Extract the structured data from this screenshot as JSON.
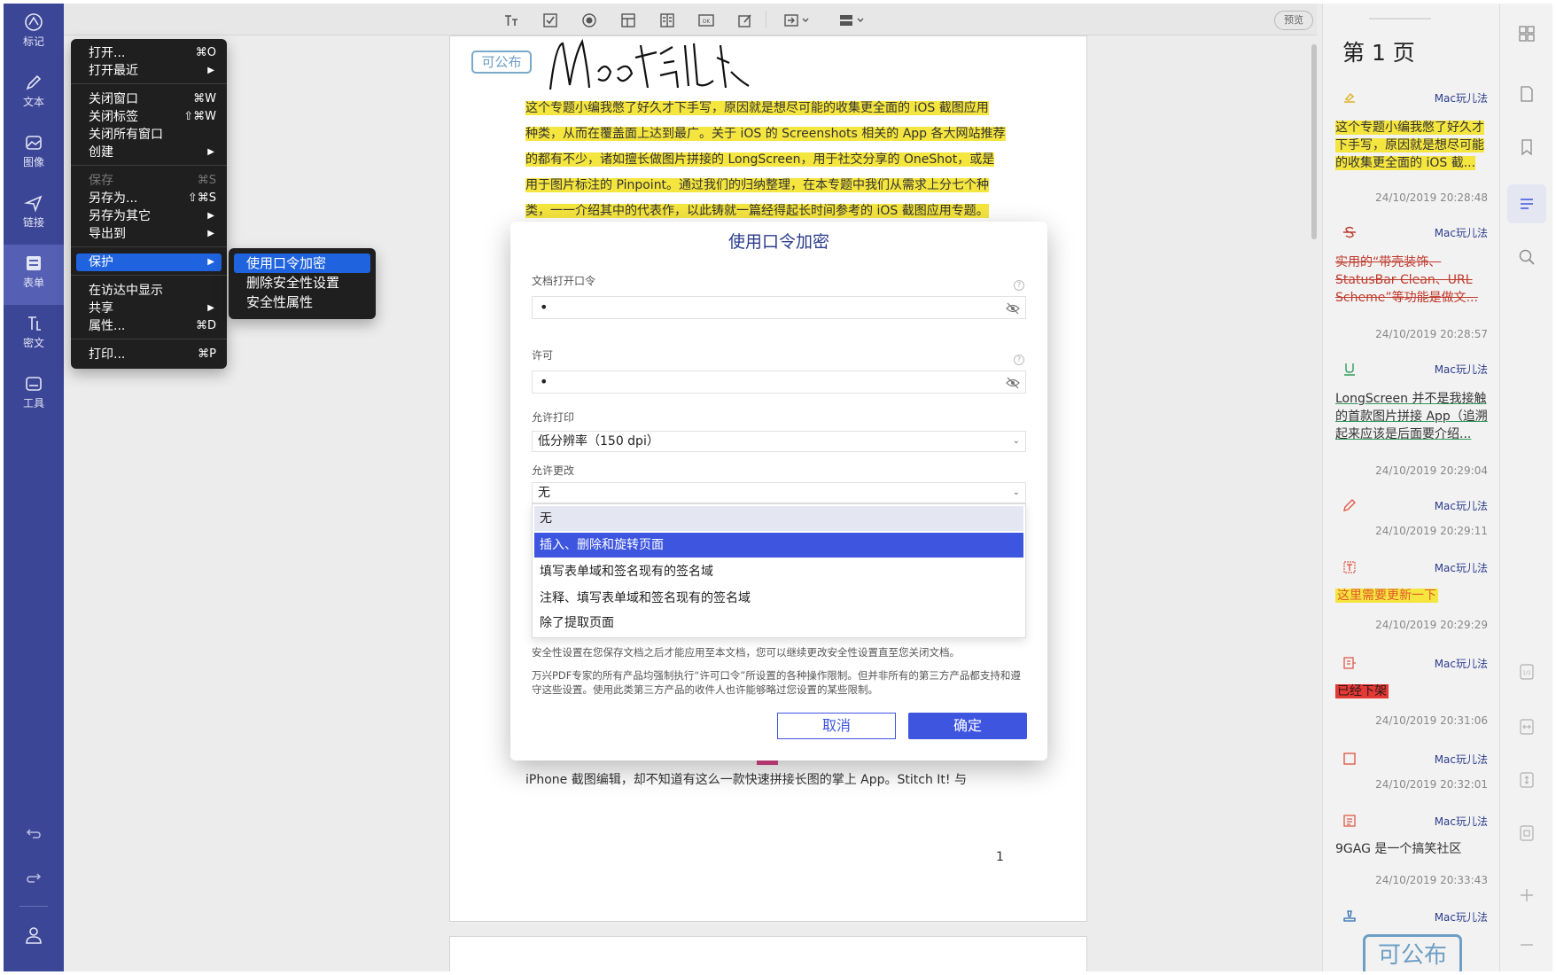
{
  "nav": {
    "items": [
      {
        "label": "标记",
        "icon": "markup-icon"
      },
      {
        "label": "文本",
        "icon": "pencil-icon"
      },
      {
        "label": "图像",
        "icon": "image-icon"
      },
      {
        "label": "链接",
        "icon": "link-icon"
      },
      {
        "label": "表单",
        "icon": "form-icon"
      },
      {
        "label": "密文",
        "icon": "redact-icon"
      },
      {
        "label": "工具",
        "icon": "tools-icon"
      }
    ]
  },
  "toolbar": {
    "preview_label": "预览"
  },
  "file_menu": {
    "open": "打开...",
    "open_sc": "⌘O",
    "recent": "打开最近",
    "close_window": "关闭窗口",
    "close_window_sc": "⌘W",
    "close_tab": "关闭标签",
    "close_tab_sc": "⇧⌘W",
    "close_all": "关闭所有窗口",
    "create": "创建",
    "save": "保存",
    "save_sc": "⌘S",
    "save_as": "另存为...",
    "save_as_sc": "⇧⌘S",
    "save_other": "另存为其它",
    "export": "导出到",
    "protect": "保护",
    "show_finder": "在访达中显示",
    "share": "共享",
    "properties": "属性...",
    "properties_sc": "⌘D",
    "print": "打印...",
    "print_sc": "⌘P"
  },
  "protect_menu": {
    "encrypt": "使用口令加密",
    "remove": "删除安全性设置",
    "properties": "安全性属性"
  },
  "document": {
    "stamp": "可公布",
    "signature": "Mac玩儿法",
    "lines": [
      "这个专题小编我憋了好久才下手写，原因就是想尽可能的收集更全面的 iOS 截图应用",
      "种类，从而在覆盖面上达到最广。关于 iOS 的 Screenshots 相关的 App 各大网站推荐",
      "的都有不少，诸如擅长做图片拼接的 LongScreen，用于社交分享的 OneShot，或是",
      "用于图片标注的 Pinpoint。通过我们的归纳整理，在本专题中我们从需求上分七个种",
      "类，一一介绍其中的代表作，以此铸就一篇经得起长时间参考的 iOS 截图应用专题。"
    ],
    "body": "iPhone  截图编辑，却不知道有这么一款快速拼接长图的掌上  App。Stitch  It!  与",
    "page_number": "1"
  },
  "dialog": {
    "title": "使用口令加密",
    "open_password_label": "文档打开口令",
    "open_password_value": "•",
    "permission_label": "许可",
    "permission_value": "•",
    "allow_print_label": "允许打印",
    "allow_print_value": "低分辨率（150 dpi）",
    "allow_change_label": "允许更改",
    "allow_change_value": "无",
    "options": [
      "无",
      "插入、删除和旋转页面",
      "填写表单域和签名现有的签名域",
      "注释、填写表单域和签名现有的签名域",
      "除了提取页面"
    ],
    "selected_option": "插入、删除和旋转页面",
    "note1": "安全性设置在您保存文档之后才能应用至本文档，您可以继续更改安全性设置直至您关闭文档。",
    "note2": "万兴PDF专家的所有产品均强制执行“许可口令”所设置的各种操作限制。但并非所有的第三方产品都支持和遵守这些设置。使用此类第三方产品的收件人也许能够略过您设置的某些限制。",
    "cancel": "取消",
    "ok": "确定"
  },
  "sidebar": {
    "page_title": "第 1 页",
    "annotations": [
      {
        "icon": "highlight-icon",
        "author": "Mac玩儿法",
        "text": "这个专题小编我憋了好久才下手写，原因就是想尽可能的收集更全面的 iOS 截...",
        "time": "24/10/2019 20:28:48"
      },
      {
        "icon": "strikethrough-icon",
        "author": "Mac玩儿法",
        "text": "实用的“带壳装饰、StatusBar Clean、URL Scheme”等功能是做文...",
        "time": "24/10/2019 20:28:57"
      },
      {
        "icon": "underline-icon",
        "author": "Mac玩儿法",
        "text": "LongScreen 并不是我接触的首款图片拼接 App（追溯起来应该是后面要介绍...",
        "time": "24/10/2019 20:29:04"
      },
      {
        "icon": "pencil-icon",
        "author": "Mac玩儿法",
        "text": "",
        "time": "24/10/2019 20:29:11"
      },
      {
        "icon": "textbox-icon",
        "author": "Mac玩儿法",
        "text": "这里需要更新一下",
        "time": "24/10/2019 20:29:29"
      },
      {
        "icon": "callout-icon",
        "author": "Mac玩儿法",
        "text": "已经下架",
        "time": "24/10/2019 20:31:06"
      },
      {
        "icon": "rectangle-icon",
        "author": "Mac玩儿法",
        "text": "",
        "time": "24/10/2019 20:32:01"
      },
      {
        "icon": "note-icon",
        "author": "Mac玩儿法",
        "text": "9GAG 是一个搞笑社区",
        "time": "24/10/2019 20:33:43"
      },
      {
        "icon": "stamp-icon",
        "author": "Mac玩儿法",
        "text": "",
        "time": ""
      }
    ],
    "stamp_text": "可公布"
  },
  "colors": {
    "nav_bg": "#3c4696",
    "accent": "#3e55e0",
    "highlight": "#f5e53f",
    "menu_highlight": "#1f63de"
  }
}
